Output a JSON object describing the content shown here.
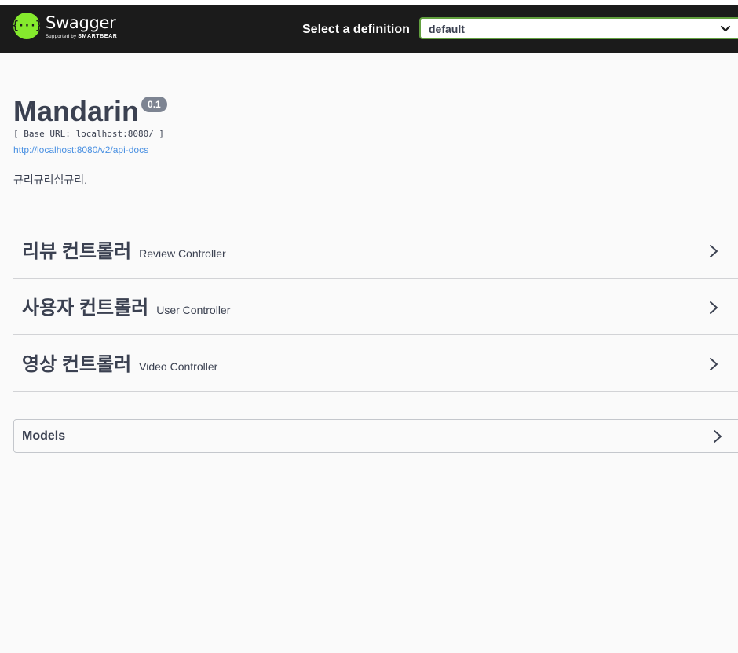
{
  "topbar": {
    "logo_name": "Swagger",
    "logo_sub_prefix": "Supported by",
    "logo_sub_brand": "SMARTBEAR",
    "select_label": "Select a definition",
    "select_value": "default",
    "logo_color": "#85ea2d",
    "background": "#1b1b1b",
    "select_border": "#62a03f"
  },
  "info": {
    "title": "Mandarin",
    "version": "0.1",
    "base_url": "[ Base URL: localhost:8080/ ]",
    "docs_link": "http://localhost:8080/v2/api-docs",
    "description": "규리규리심규리.",
    "link_color": "#4990e2"
  },
  "tags": [
    {
      "name": "리뷰 컨트롤러",
      "description": "Review Controller",
      "icon": "chevron-right-icon"
    },
    {
      "name": "사용자 컨트롤러",
      "description": "User Controller",
      "icon": "chevron-right-icon"
    },
    {
      "name": "영상 컨트롤러",
      "description": "Video Controller",
      "icon": "chevron-right-icon"
    }
  ],
  "models": {
    "label": "Models",
    "icon": "chevron-right-icon"
  }
}
